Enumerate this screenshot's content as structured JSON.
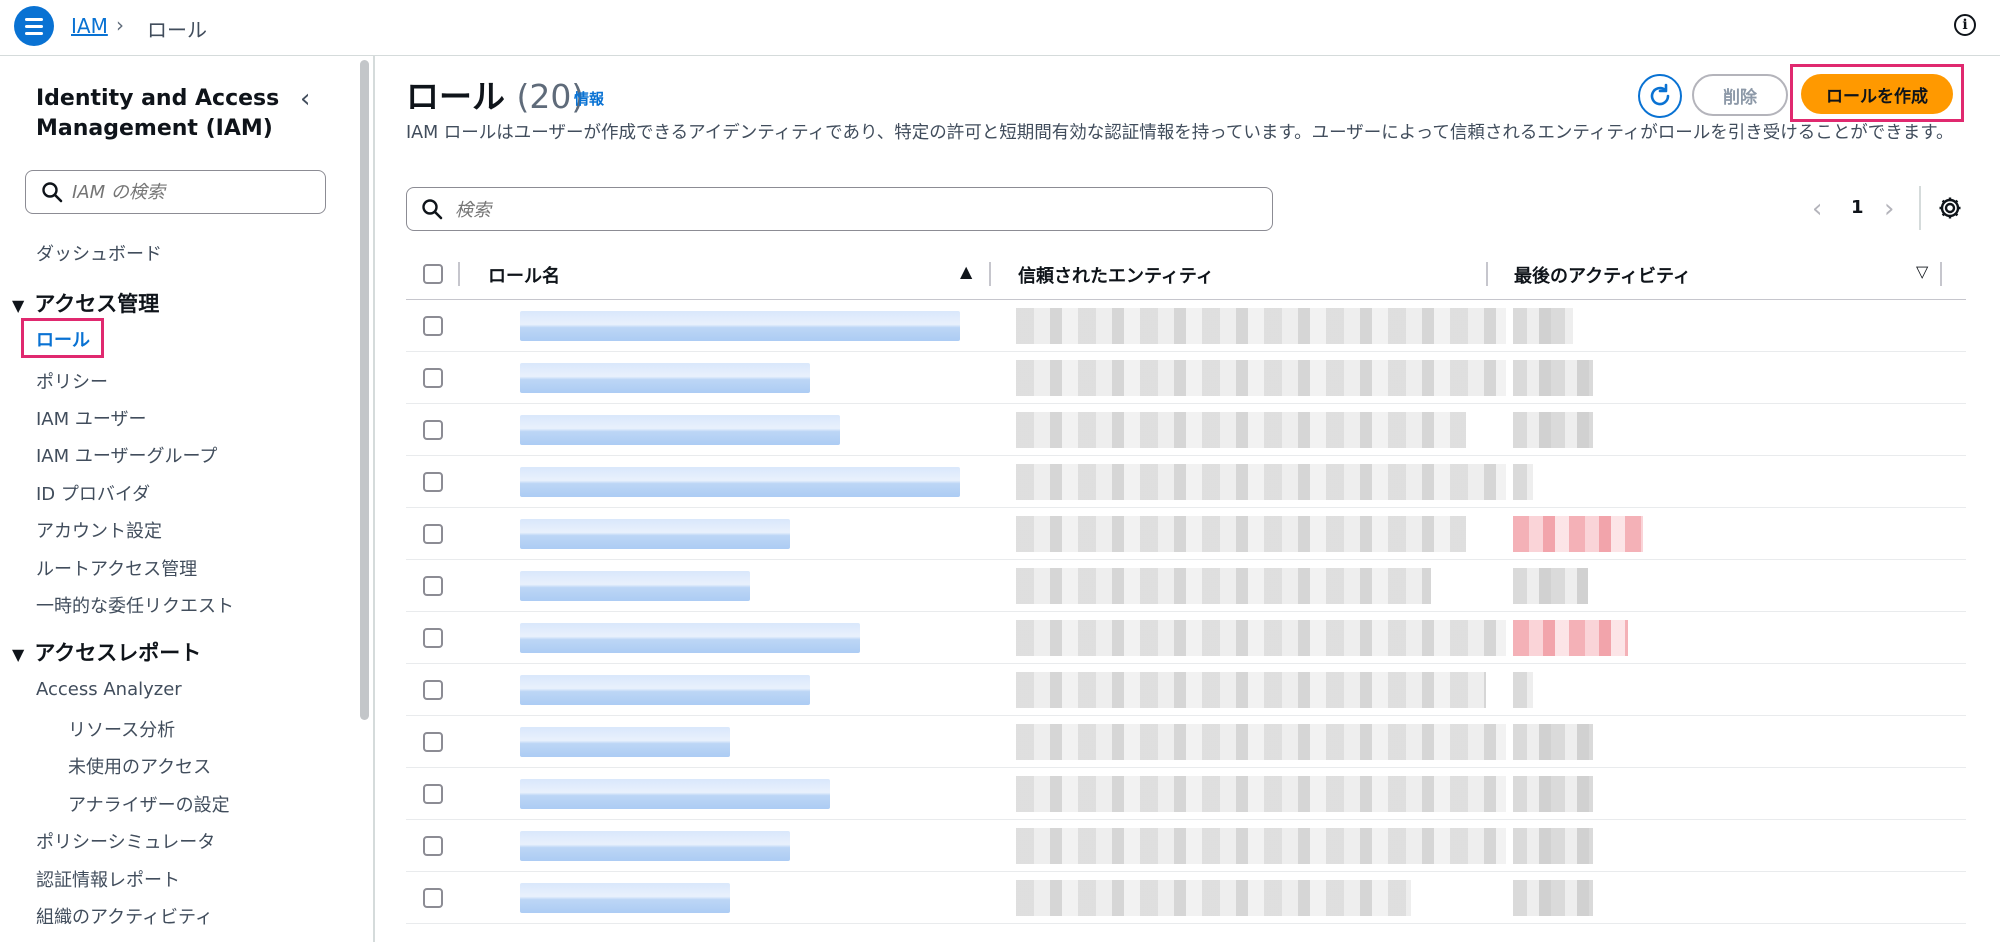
{
  "topbar": {
    "breadcrumb_root": "IAM",
    "breadcrumb_current": "ロール"
  },
  "sidebar": {
    "title": "Identity and Access Management (IAM)",
    "search_placeholder": "IAM の検索",
    "dashboard": "ダッシュボード",
    "access_mgmt": {
      "label": "アクセス管理",
      "items": [
        "ロール",
        "ポリシー",
        "IAM ユーザー",
        "IAM ユーザーグループ",
        "ID プロバイダ",
        "アカウント設定",
        "ルートアクセス管理",
        "一時的な委任リクエスト"
      ]
    },
    "access_reports": {
      "label": "アクセスレポート",
      "analyzer": "Access Analyzer",
      "analyzer_items": [
        "リソース分析",
        "未使用のアクセス",
        "アナライザーの設定"
      ],
      "items": [
        "ポリシーシミュレータ",
        "認証情報レポート",
        "組織のアクティビティ"
      ]
    }
  },
  "main": {
    "title": "ロール",
    "count": "(20)",
    "info_link": "情報",
    "description": "IAM ロールはユーザーが作成できるアイデンティティであり、特定の許可と短期間有効な認証情報を持っています。ユーザーによって信頼されるエンティティがロールを引き受けることができます。",
    "delete_label": "削除",
    "create_label": "ロールを作成",
    "search_placeholder": "検索",
    "page_number": "1",
    "columns": [
      "ロール名",
      "信頼されたエンティティ",
      "最後のアクティビティ"
    ],
    "rows_visible": 12
  },
  "colors": {
    "accent": "#0972d3",
    "primary_button": "#ff9900",
    "highlight_border": "#e0296f"
  },
  "icons": [
    "menu-icon",
    "chevron-right-icon",
    "info-icon",
    "chevron-left-icon",
    "search-icon",
    "refresh-icon",
    "settings-gear-icon",
    "sort-ascending-icon",
    "sort-descending-icon",
    "collapse-triangle-icon"
  ]
}
